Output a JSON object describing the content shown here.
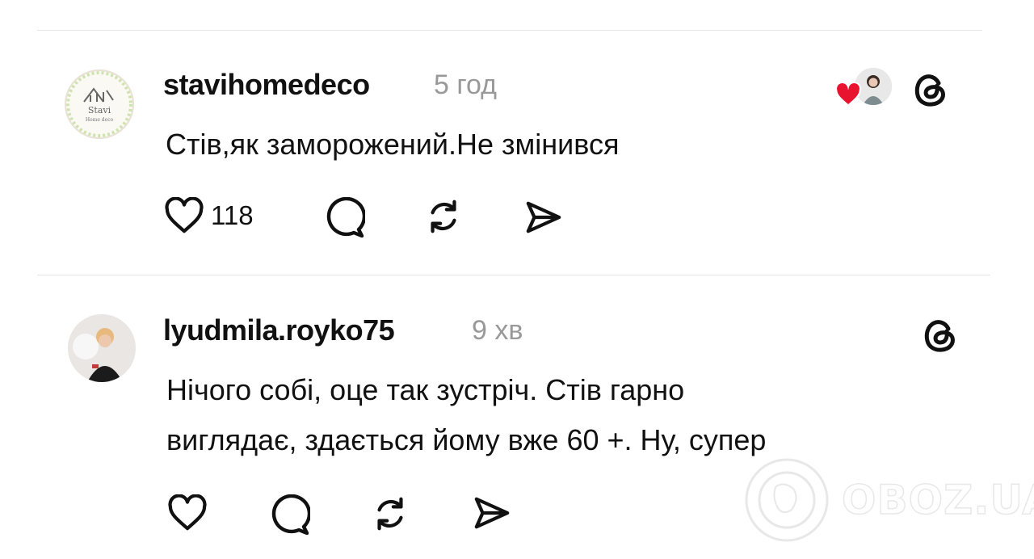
{
  "posts": [
    {
      "username": "stavihomedeco",
      "time": "5 год",
      "avatar_logo_text": "Stavi",
      "avatar_logo_sub": "Home deco",
      "text_lines": [
        "Стів,як заморожений.Не змінився"
      ],
      "like_count": "118",
      "liked_by_indicator": true
    },
    {
      "username": "lyudmila.royko75",
      "time": "9 хв",
      "text_lines": [
        "Нічого собі, оце так зустріч. Стів гарно",
        "виглядає, здається йому вже 60 +. Ну, супер"
      ],
      "like_count": ""
    }
  ],
  "watermark": {
    "text": "OBOZ.UA"
  },
  "colors": {
    "heart": "#e8132f",
    "muted": "#999999",
    "divider": "#e6e6e6"
  }
}
